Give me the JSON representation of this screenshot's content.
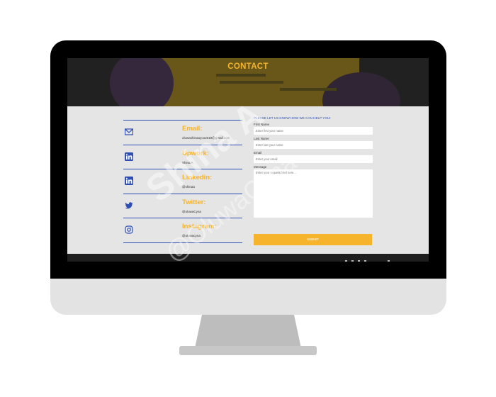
{
  "hero": {
    "title": "CONTACT"
  },
  "contacts": [
    {
      "label": "Email:",
      "value": "oluwashinaayoo2019@gmail.com",
      "icon": "envelope-icon"
    },
    {
      "label": "Upwork:",
      "value": "Shina A",
      "icon": "linkedin-icon"
    },
    {
      "label": "Linkedin:",
      "value": "@shinaa",
      "icon": "linkedin-icon"
    },
    {
      "label": "Twitter:",
      "value": "@oluwaCyna",
      "icon": "twitter-icon"
    },
    {
      "label": "Instagram:",
      "value": "@oluwacyna",
      "icon": "instagram-icon"
    }
  ],
  "form": {
    "heading": "PLEASE LET US KNOW HOW WE CAN HELP YOU!",
    "first_name_label": "First Name",
    "first_name_placeholder": "Enter first your name",
    "last_name_label": "Last Name",
    "last_name_placeholder": "Enter last your name",
    "email_label": "Email",
    "email_placeholder": "Enter your email",
    "message_label": "Message",
    "message_placeholder": "Enter your request/brief here...",
    "submit_label": "SUBMIT"
  },
  "watermark": {
    "line1": "Shina A",
    "line2": "@OluwaCyna"
  },
  "colors": {
    "accent": "#f5b42c",
    "link_blue": "#2f4fb0",
    "screen_bg": "#e5e5e5",
    "bezel": "#000000",
    "chin": "#e3e3e3"
  }
}
